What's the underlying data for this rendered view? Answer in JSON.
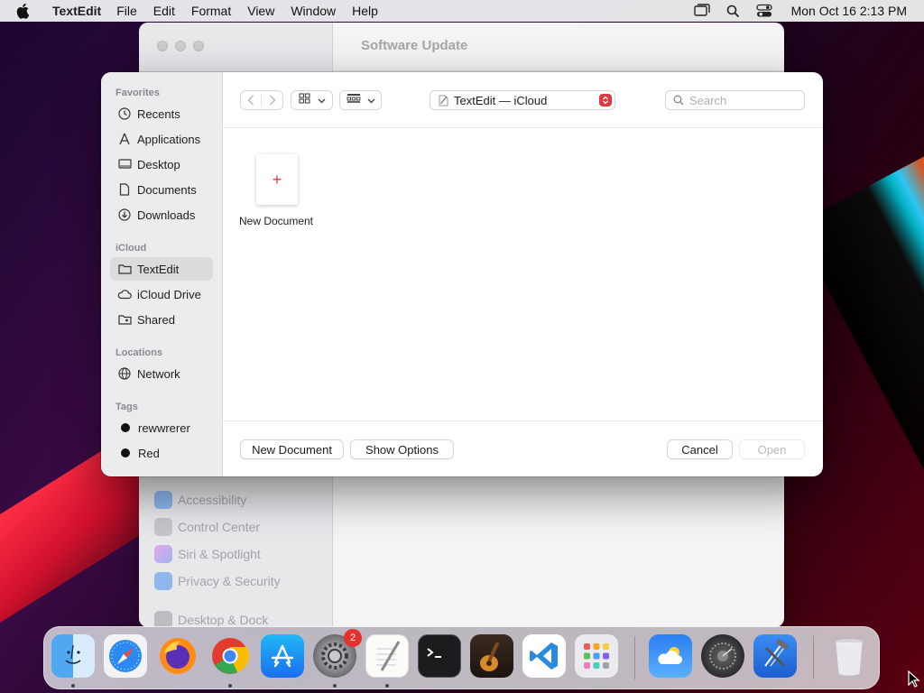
{
  "menubar": {
    "app_name": "TextEdit",
    "menus": [
      "File",
      "Edit",
      "Format",
      "View",
      "Window",
      "Help"
    ],
    "clock": "Mon Oct 16  2:13 PM",
    "icons": [
      "window-switcher-icon",
      "search-icon",
      "control-center-icon"
    ]
  },
  "bg_window": {
    "title": "Software Update",
    "items": [
      "Accessibility",
      "Control Center",
      "Siri & Spotlight",
      "Privacy & Security",
      "Desktop & Dock"
    ]
  },
  "dialog": {
    "sidebar": {
      "favorites_header": "Favorites",
      "favorites": [
        "Recents",
        "Applications",
        "Desktop",
        "Documents",
        "Downloads"
      ],
      "icloud_header": "iCloud",
      "icloud": [
        "TextEdit",
        "iCloud Drive",
        "Shared"
      ],
      "locations_header": "Locations",
      "locations": [
        "Network"
      ],
      "tags_header": "Tags",
      "tags": [
        "rewwrerer",
        "Red"
      ],
      "selected": "TextEdit"
    },
    "toolbar": {
      "location": "TextEdit — iCloud",
      "search_placeholder": "Search"
    },
    "content": {
      "doc_label": "New Document",
      "doc_glyph": "+"
    },
    "footer": {
      "new_document": "New Document",
      "show_options": "Show Options",
      "cancel": "Cancel",
      "open": "Open"
    }
  },
  "dock": {
    "apps": [
      "Finder",
      "Safari",
      "Firefox",
      "Chrome",
      "App Store",
      "System Settings",
      "TextEdit",
      "Terminal",
      "GarageBand",
      "VS Code",
      "Launchpad",
      "Weather",
      "Disk Utility",
      "Xcode",
      "Trash"
    ],
    "settings_badge": "2"
  }
}
